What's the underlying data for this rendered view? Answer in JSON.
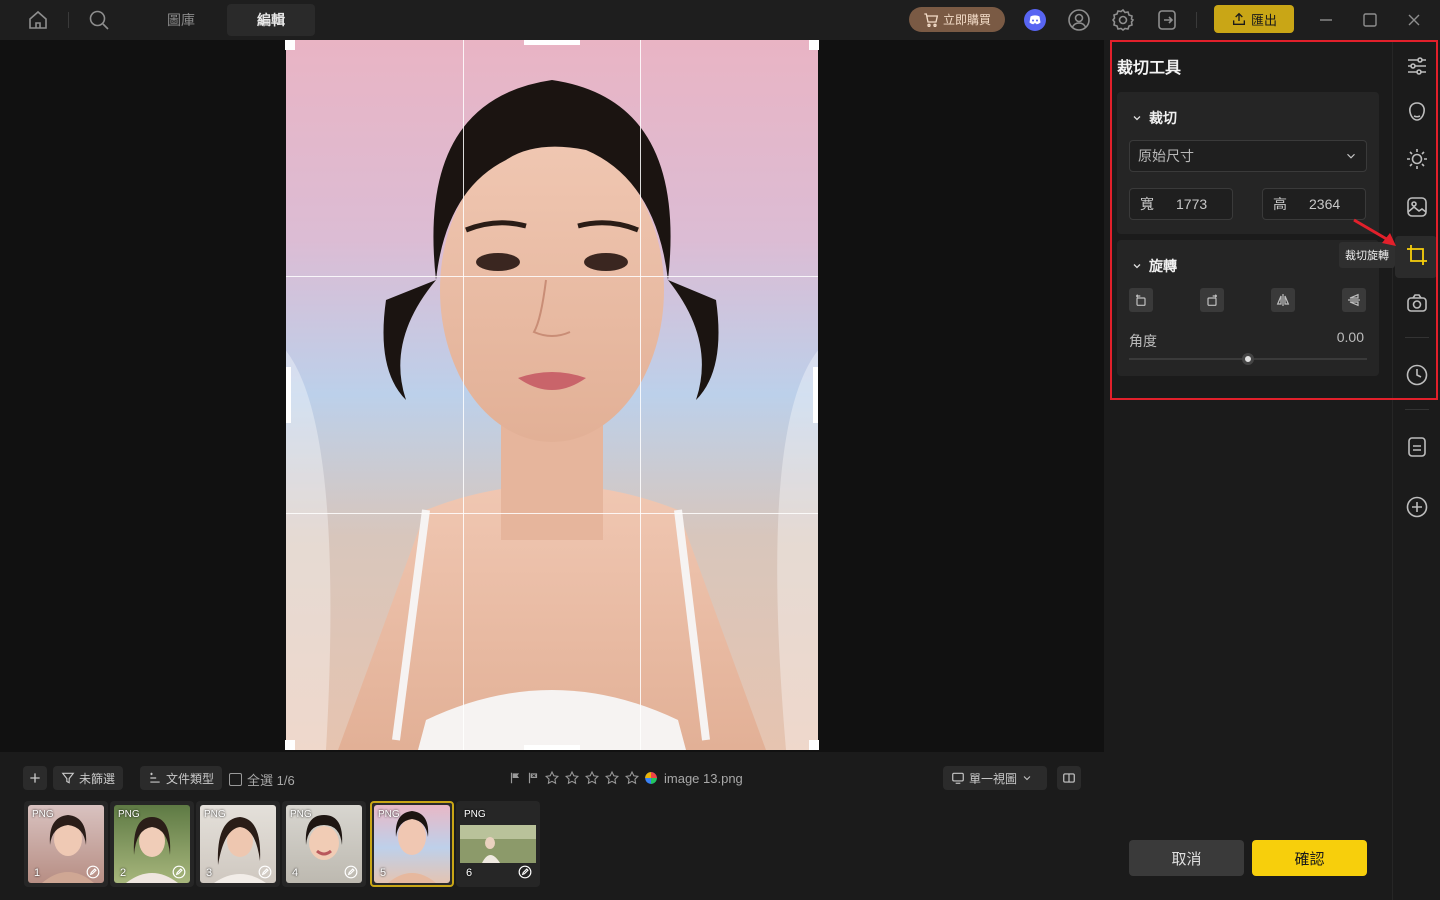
{
  "titlebar": {
    "tabs": [
      {
        "label": "圖庫"
      },
      {
        "label": "編輯"
      }
    ],
    "buy_label": "立即購買",
    "export_label": "匯出",
    "colors": {
      "buy": "#7a5a44",
      "export": "#c9a616",
      "discord": "#5865f2"
    }
  },
  "canvas": {
    "grid": "rule-of-thirds"
  },
  "bottombar": {
    "add_icon": "plus-icon",
    "filter_label": "未篩選",
    "sort_label": "文件類型",
    "select_all_label": "全選 1/6",
    "file_name": "image 13.png",
    "rating_stars": 5,
    "view_label": "單一視圖",
    "thumbnails": [
      {
        "type": "PNG",
        "number": "1",
        "selected": false
      },
      {
        "type": "PNG",
        "number": "2",
        "selected": false
      },
      {
        "type": "PNG",
        "number": "3",
        "selected": false
      },
      {
        "type": "PNG",
        "number": "4",
        "selected": false
      },
      {
        "type": "PNG",
        "number": "5",
        "selected": true
      },
      {
        "type": "PNG",
        "number": "6",
        "selected": false
      }
    ]
  },
  "panel": {
    "title": "裁切工具",
    "crop": {
      "section_label": "裁切",
      "ratio_value": "原始尺寸",
      "width_label": "寬",
      "width_value": "1773",
      "height_label": "高",
      "height_value": "2364"
    },
    "rotate": {
      "section_label": "旋轉",
      "angle_label": "角度",
      "angle_value": "0.00",
      "buttons": [
        "rotate-left-icon",
        "rotate-right-icon",
        "flip-horizontal-icon",
        "flip-vertical-icon"
      ]
    },
    "cancel_label": "取消",
    "confirm_label": "確認",
    "accent": "#f7cf0c"
  },
  "iconrail": {
    "tooltip": "裁切旋轉",
    "active": "crop-rotate-icon"
  },
  "highlight_color": "#e2202b"
}
